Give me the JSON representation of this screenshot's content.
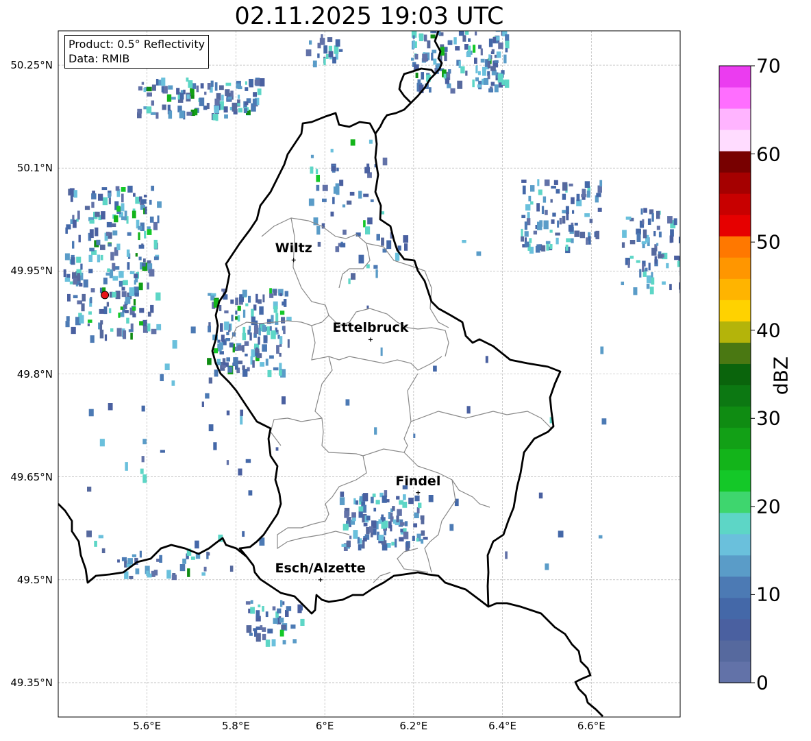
{
  "title": "02.11.2025 19:03 UTC",
  "info": {
    "product": "Product: 0.5° Reflectivity",
    "data": "Data: RMIB"
  },
  "map": {
    "lon_range": [
      5.4,
      6.8
    ],
    "lat_range": [
      49.3,
      50.3
    ],
    "lat_ticks": [
      {
        "value": 50.25,
        "label": "50.25°N"
      },
      {
        "value": 50.1,
        "label": "50.1°N"
      },
      {
        "value": 49.95,
        "label": "49.95°N"
      },
      {
        "value": 49.8,
        "label": "49.8°N"
      },
      {
        "value": 49.65,
        "label": "49.65°N"
      },
      {
        "value": 49.5,
        "label": "49.5°N"
      },
      {
        "value": 49.35,
        "label": "49.35°N"
      }
    ],
    "lon_ticks": [
      {
        "value": 5.6,
        "label": "5.6°E"
      },
      {
        "value": 5.8,
        "label": "5.8°E"
      },
      {
        "value": 6.0,
        "label": "6°E"
      },
      {
        "value": 6.2,
        "label": "6.2°E"
      },
      {
        "value": 6.4,
        "label": "6.4°E"
      },
      {
        "value": 6.6,
        "label": "6.6°E"
      }
    ],
    "cities": [
      {
        "name": "Wiltz",
        "lon": 5.93,
        "lat": 49.966
      },
      {
        "name": "Ettelbruck",
        "lon": 6.103,
        "lat": 49.85
      },
      {
        "name": "Findel",
        "lon": 6.21,
        "lat": 49.627
      },
      {
        "name": "Esch/Alzette",
        "lon": 5.99,
        "lat": 49.5
      }
    ],
    "radar_site": {
      "lon": 5.505,
      "lat": 49.915,
      "color": "#e8141a"
    }
  },
  "colorbar": {
    "label": "dBZ",
    "min": 0,
    "max": 70,
    "ticks": [
      "0",
      "10",
      "20",
      "30",
      "40",
      "50",
      "60",
      "70"
    ],
    "colors": [
      "#6272a8",
      "#56699e",
      "#4a60a0",
      "#4468a8",
      "#4c7ab4",
      "#5a9cc8",
      "#6ac0dc",
      "#5dd6c6",
      "#3ed66e",
      "#14c828",
      "#13b41a",
      "#12a016",
      "#0f8c12",
      "#0c7812",
      "#0a640c",
      "#4a7812",
      "#b4b40a",
      "#ffd200",
      "#ffb400",
      "#ff9600",
      "#ff7800",
      "#e60000",
      "#c80000",
      "#a50000",
      "#780000",
      "#ffdcff",
      "#ffb4ff",
      "#ff6eff",
      "#eb3cf0"
    ]
  }
}
